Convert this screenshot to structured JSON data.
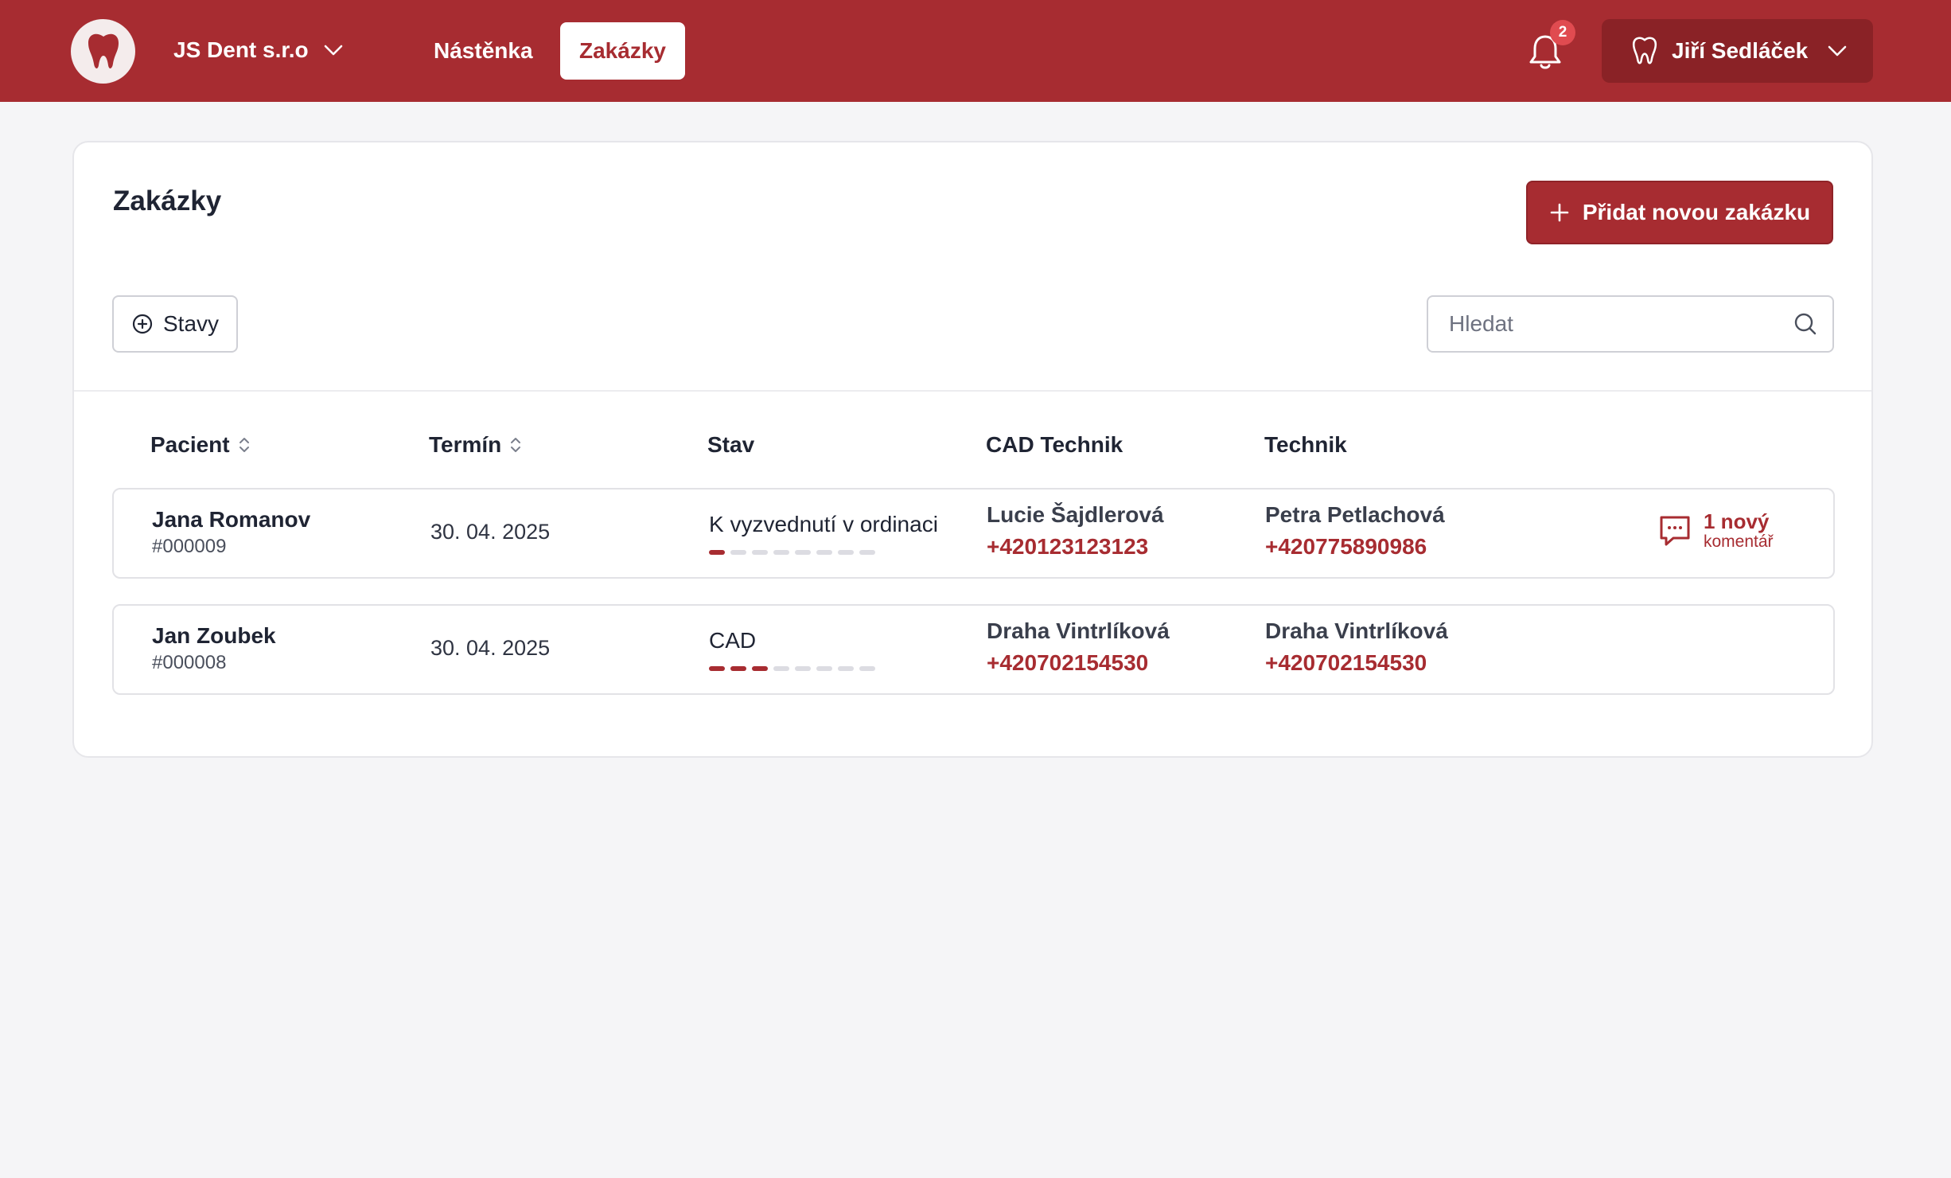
{
  "header": {
    "company": "JS Dent s.r.o",
    "nav": [
      {
        "label": "Nástěnka"
      },
      {
        "label": "Zakázky"
      }
    ],
    "notifications_count": "2",
    "user_name": "Jiří Sedláček"
  },
  "colors": {
    "brand": "#a72c31",
    "brand_dark": "#8a2226",
    "badge": "#e04b50",
    "background": "#f5f5f7"
  },
  "icons": [
    "tooth-icon",
    "chevron-down-icon",
    "bell-icon",
    "plus-icon",
    "plus-circle-icon",
    "search-icon",
    "sort-icon",
    "chat-icon"
  ],
  "page": {
    "title": "Zakázky",
    "add_button": "Přidat novou zakázku",
    "filter_button": "Stavy",
    "search_placeholder": "Hledat"
  },
  "table": {
    "columns": [
      "Pacient",
      "Termín",
      "Stav",
      "CAD Technik",
      "Technik"
    ],
    "rows": [
      {
        "patient": "Jana Romanov",
        "id": "#000009",
        "date": "30. 04. 2025",
        "status": "K vyzvednutí v ordinaci",
        "progress_steps_done": 1,
        "progress_steps_total": 8,
        "cad_name": "Lucie Šajdlerová",
        "cad_phone": "+420123123123",
        "tech_name": "Petra Petlachová",
        "tech_phone": "+420775890986",
        "comment_count": "1 nový",
        "comment_label": "komentář"
      },
      {
        "patient": "Jan Zoubek",
        "id": "#000008",
        "date": "30. 04. 2025",
        "status": "CAD",
        "progress_steps_done": 3,
        "progress_steps_total": 8,
        "cad_name": "Draha Vintrlíková",
        "cad_phone": "+420702154530",
        "tech_name": "Draha Vintrlíková",
        "tech_phone": "+420702154530"
      }
    ]
  }
}
